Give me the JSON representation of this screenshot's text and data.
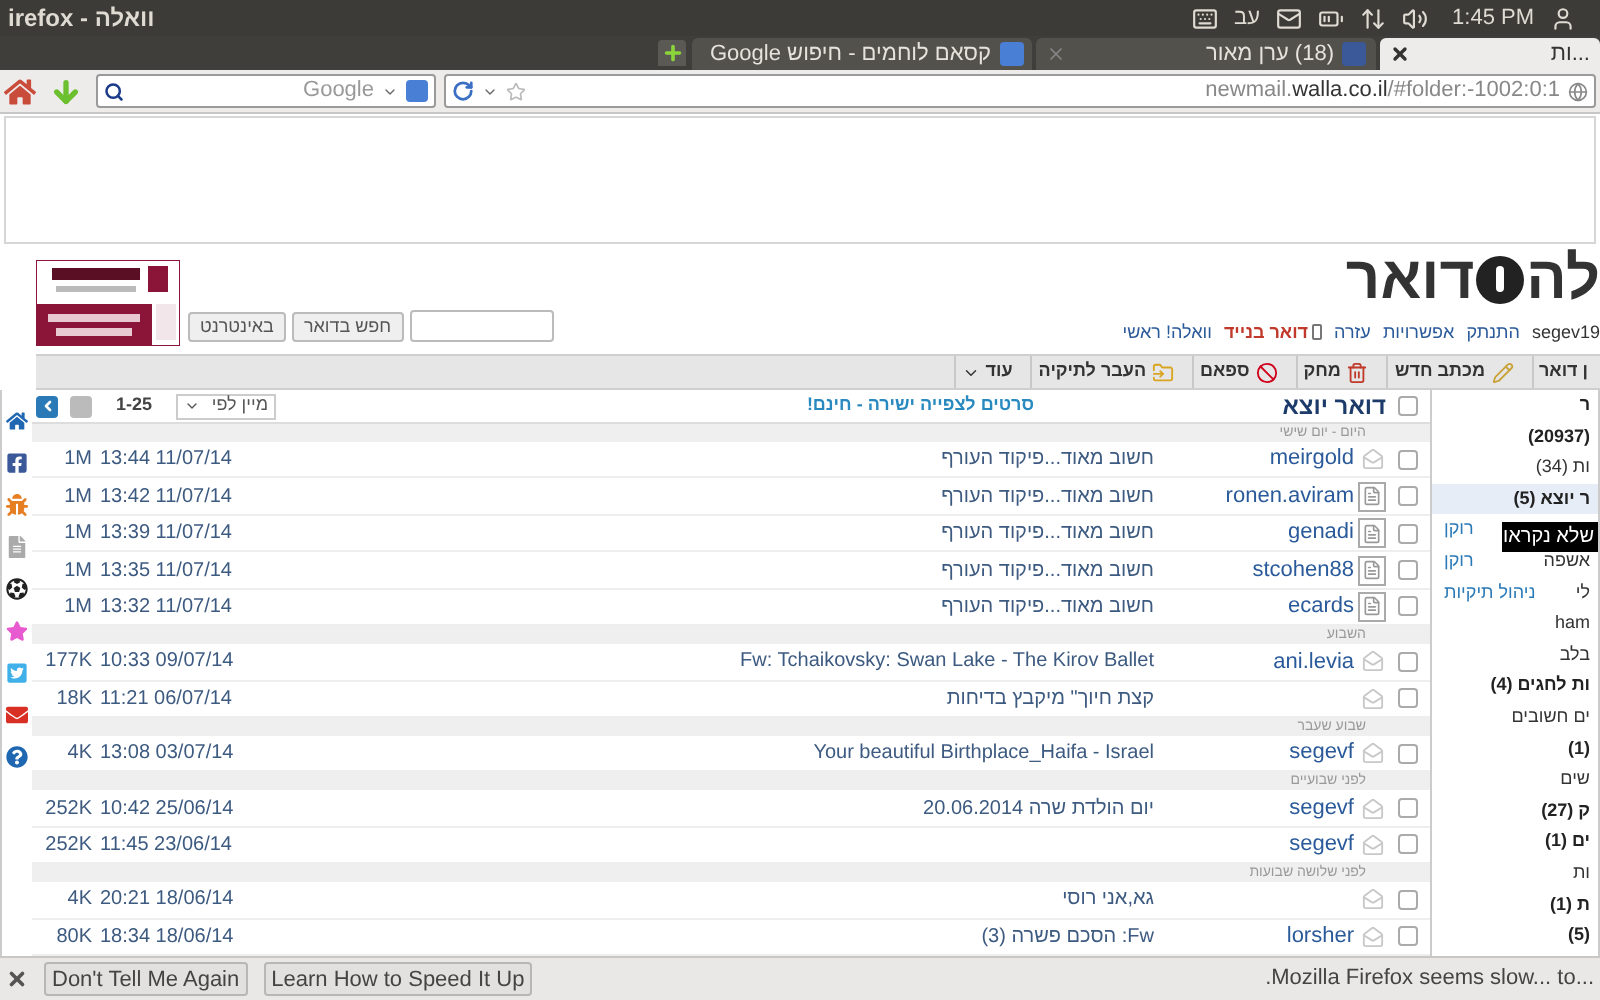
{
  "window": {
    "title": "irefox - וואלה"
  },
  "panel": {
    "keyboard_layout": "עב",
    "clock": "1:45 PM"
  },
  "tabs": [
    {
      "label": "...ות",
      "selected": true,
      "kind": "plain"
    },
    {
      "label": "(18) ערן מאור",
      "selected": false,
      "kind": "social"
    },
    {
      "label": "קסאם לוחמים - חיפוש Google",
      "selected": false,
      "kind": "search"
    }
  ],
  "search_bar": {
    "placeholder": "Google"
  },
  "url_bar": {
    "prefix": "newmail.",
    "domain": "walla.co.il",
    "path": "/#folder:-1002:0:1"
  },
  "mail_header": {
    "logo_text": "לה",
    "logo_word": "דואר",
    "user": "segev19",
    "links": [
      {
        "label": "התנתק",
        "kind": "link"
      },
      {
        "label": "אפשרויות",
        "kind": "link"
      },
      {
        "label": "עזרה",
        "kind": "link"
      },
      {
        "label": "דואר בנייד",
        "kind": "mobile"
      },
      {
        "label": "וואלה! ראשי",
        "kind": "link"
      }
    ],
    "search_buttons": [
      "חפש בדואר",
      "באינטרנט"
    ]
  },
  "toolbar": [
    {
      "label": "ן דואר",
      "kind": "plain"
    },
    {
      "label": "מכתב חדש",
      "kind": "compose"
    },
    {
      "label": "מחק",
      "kind": "delete"
    },
    {
      "label": "ספאם",
      "kind": "spam"
    },
    {
      "label": "העבר לתיקיה",
      "kind": "move"
    },
    {
      "label": "עוד",
      "kind": "menu"
    }
  ],
  "folder": {
    "title": "דואר יוצא",
    "promo": "סרטים לצפייה ישירה - חינם!",
    "sort": "מיין לפי",
    "range": "1-25",
    "select_all": false
  },
  "rows": [
    {
      "kind": "group",
      "label": "היום - יום שישי"
    },
    {
      "kind": "message",
      "checked": false,
      "sender": "meirgold",
      "subject": "חשוב מאוד...פיקוד העורף",
      "date": "13:44 11/07/14",
      "size": "1M"
    },
    {
      "kind": "file_message",
      "checked": false,
      "sender": "ronen.aviram",
      "subject": "חשוב מאוד...פיקוד העורף",
      "date": "13:42 11/07/14",
      "size": "1M"
    },
    {
      "kind": "file_message",
      "checked": false,
      "sender": "genadi",
      "subject": "חשוב מאוד...פיקוד העורף",
      "date": "13:39 11/07/14",
      "size": "1M"
    },
    {
      "kind": "file_message",
      "checked": false,
      "sender": "stcohen88",
      "subject": "חשוב מאוד...פיקוד העורף",
      "date": "13:35 11/07/14",
      "size": "1M"
    },
    {
      "kind": "file_message",
      "checked": false,
      "sender": "ecards",
      "subject": "חשוב מאוד...פיקוד העורף",
      "date": "13:32 11/07/14",
      "size": "1M"
    },
    {
      "kind": "group",
      "label": "השבוע"
    },
    {
      "kind": "message",
      "checked": false,
      "sender": "ani.levia",
      "subject": "Fw: Tchaikovsky: Swan Lake - The Kirov Ballet",
      "date": "10:33 09/07/14",
      "size": "177K"
    },
    {
      "kind": "message",
      "checked": false,
      "subject": "קצת חיוך\" מיקבץ בדיחות",
      "date": "11:21 06/07/14",
      "size": "18K"
    },
    {
      "kind": "group",
      "label": "שבוע שעבר"
    },
    {
      "kind": "message",
      "checked": false,
      "sender": "segevf",
      "subject": "Your beautiful Birthplace_Haifa - Israel",
      "date": "13:08 03/07/14",
      "size": "4K"
    },
    {
      "kind": "group",
      "label": "לפני שבועיים"
    },
    {
      "kind": "message",
      "checked": false,
      "sender": "segevf",
      "subject": "יום הולדת שרה 20.06.2014",
      "date": "10:42 25/06/14",
      "size": "252K"
    },
    {
      "kind": "message",
      "checked": false,
      "sender": "segevf",
      "date": "11:45 23/06/14",
      "size": "252K"
    },
    {
      "kind": "group",
      "label": "לפני שלושה שבועות"
    },
    {
      "kind": "message",
      "checked": false,
      "subject": "גא,אני רוסי",
      "date": "20:21 18/06/14",
      "size": "4K"
    },
    {
      "kind": "message",
      "checked": false,
      "sender": "lorsher",
      "subject": "Fw: הסכם פשרה (3)",
      "date": "18:34 18/06/14",
      "size": "80K"
    }
  ],
  "folders": [
    {
      "label": "ר",
      "unread": true,
      "selected": false
    },
    {
      "label": "(20937)",
      "unread": true,
      "selected": false
    },
    {
      "label": "ות (34)",
      "unread": false,
      "selected": false
    },
    {
      "label": "ר יוצא (5)",
      "unread": true,
      "selected": true
    },
    {
      "action": "רוקן",
      "selected": false
    },
    {
      "label": "אשפה",
      "action": "רוקן",
      "unread": false,
      "selected": false
    },
    {
      "label": "לי",
      "action": "ניהול תיקיות",
      "unread": false,
      "selected": false
    },
    {
      "label": "ham",
      "unread": false,
      "selected": false
    },
    {
      "label": "בלב",
      "unread": false,
      "selected": false
    },
    {
      "label": "ות לחגים (4)",
      "unread": true,
      "selected": false
    },
    {
      "label": "ים חשובים",
      "unread": false,
      "selected": false
    },
    {
      "label": "(1)",
      "unread": true,
      "selected": false
    },
    {
      "label": "שים",
      "unread": false,
      "selected": false
    },
    {
      "label": "ק (27)",
      "unread": true,
      "selected": false
    },
    {
      "label": "ים (1)",
      "unread": true,
      "selected": false
    },
    {
      "label": "ות",
      "unread": false,
      "selected": false
    },
    {
      "label": "ת (1)",
      "unread": true,
      "selected": false
    },
    {
      "label": "(5)",
      "unread": true,
      "selected": false
    }
  ],
  "tooltip": "שלא נקראו",
  "notification": {
    "buttons": [
      "Learn How to Speed It Up",
      "Don't Tell Me Again"
    ],
    "message": ".Mozilla Firefox seems slow... to..."
  }
}
